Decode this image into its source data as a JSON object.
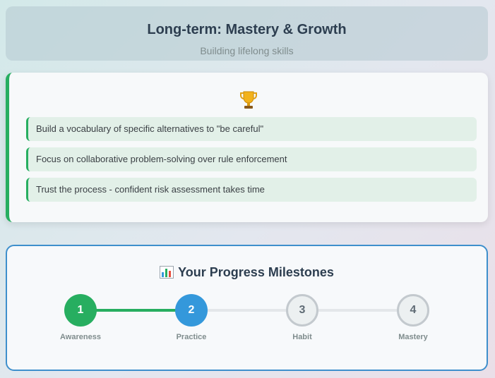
{
  "header": {
    "title": "Long-term: Mastery & Growth",
    "subtitle": "Building lifelong skills"
  },
  "tips_card": {
    "icon": "trophy-icon",
    "items": [
      "Build a vocabulary of specific alternatives to \"be careful\"",
      "Focus on collaborative problem-solving over rule enforcement",
      "Trust the process - confident risk assessment takes time"
    ]
  },
  "progress": {
    "icon": "bar-chart-icon",
    "title": "Your Progress Milestones",
    "current_step": 2,
    "steps": [
      {
        "number": "1",
        "label": "Awareness",
        "status": "done"
      },
      {
        "number": "2",
        "label": "Practice",
        "status": "current"
      },
      {
        "number": "3",
        "label": "Habit",
        "status": "pending"
      },
      {
        "number": "4",
        "label": "Mastery",
        "status": "pending"
      }
    ]
  },
  "colors": {
    "accent_green": "#27ae60",
    "accent_blue": "#3498db",
    "card_border_blue": "#3e8fcc",
    "title_text": "#2d3e50"
  }
}
